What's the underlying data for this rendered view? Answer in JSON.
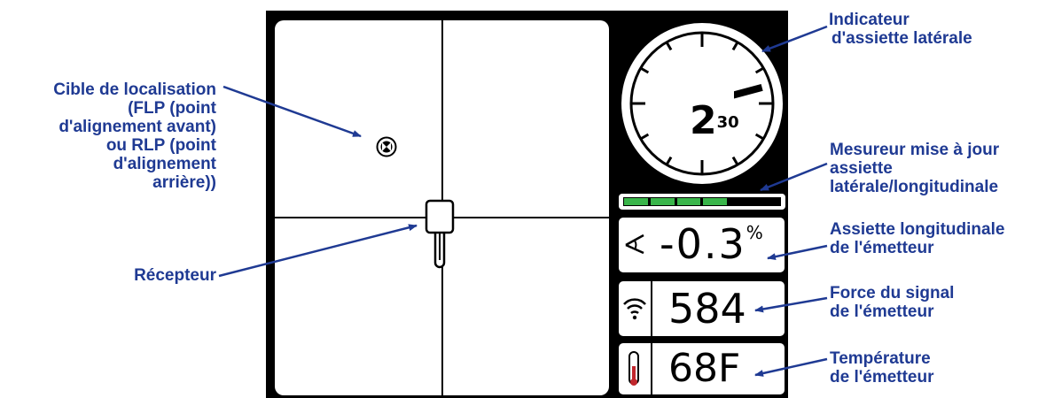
{
  "display": {
    "roll_gauge": {
      "hours": "2",
      "minutes": "30"
    },
    "update_meter": {
      "segments_total": 6,
      "segments_filled": 4,
      "fill_color": "#39b54a"
    },
    "pitch": {
      "icon": "pitch-icon",
      "value": "-0.3",
      "unit": "%"
    },
    "signal": {
      "icon": "wifi-signal-icon",
      "value": "584"
    },
    "temperature": {
      "icon": "thermometer-icon",
      "value": "68F"
    },
    "target_icon": "locate-target-icon",
    "receiver_icon": "receiver-icon"
  },
  "callouts": {
    "locate_target": [
      "Cible de localisation",
      "(FLP (point",
      "d'alignement avant)",
      "ou RLP (point",
      "d'alignement",
      "arrière))"
    ],
    "receiver": [
      "Récepteur"
    ],
    "roll_indicator": [
      "Indicateur",
      "d'assiette latérale"
    ],
    "update_meter": [
      "Mesureur mise à jour",
      "assiette",
      "latérale/longitudinale"
    ],
    "pitch": [
      "Assiette longitudinale",
      "de l'émetteur"
    ],
    "signal": [
      "Force du signal",
      "de l'émetteur"
    ],
    "temperature": [
      "Température",
      "de l'émetteur"
    ]
  },
  "colors": {
    "callout_text": "#1f3a93",
    "screen_background": "#000000",
    "thermometer_fill": "#c1272d"
  }
}
